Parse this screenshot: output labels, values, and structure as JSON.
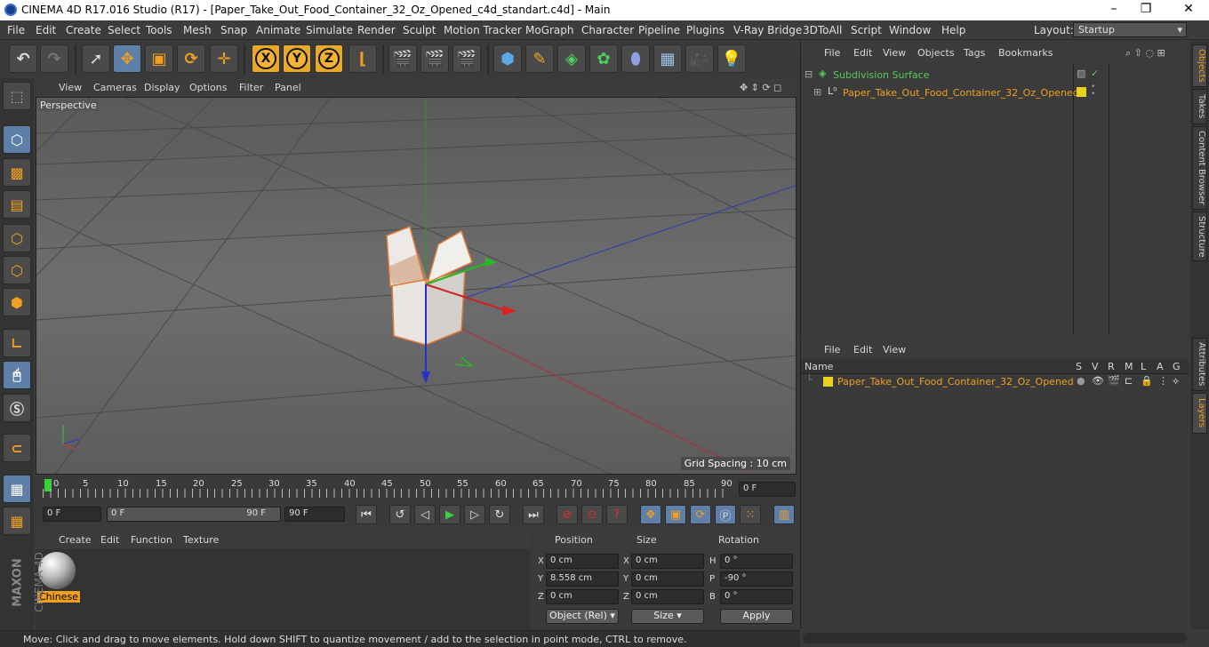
{
  "window": {
    "title": "CINEMA 4D R17.016 Studio (R17) - [Paper_Take_Out_Food_Container_32_Oz_Opened_c4d_standart.c4d] - Main",
    "layout_label": "Layout:",
    "layout_value": "Startup"
  },
  "menubar": [
    "File",
    "Edit",
    "Create",
    "Select",
    "Tools",
    "Mesh",
    "Snap",
    "Animate",
    "Simulate",
    "Render",
    "Sculpt",
    "Motion Tracker",
    "MoGraph",
    "Character",
    "Pipeline",
    "Plugins",
    "V-Ray Bridge",
    "3DToAll",
    "Script",
    "Window",
    "Help"
  ],
  "toolbar": {
    "x_label": "X",
    "y_label": "Y",
    "z_label": "Z"
  },
  "viewport": {
    "menu": [
      "View",
      "Cameras",
      "Display",
      "Options",
      "Filter",
      "Panel"
    ],
    "label": "Perspective",
    "grid_spacing": "Grid Spacing : 10 cm"
  },
  "timeline": {
    "ticks": [
      "0",
      "5",
      "10",
      "15",
      "20",
      "25",
      "30",
      "35",
      "40",
      "45",
      "50",
      "55",
      "60",
      "65",
      "70",
      "75",
      "80",
      "85",
      "90"
    ],
    "current_frame": "0 F",
    "start_field": "0 F",
    "range_start": "0 F",
    "range_end": "90 F",
    "end_field": "90 F"
  },
  "materials": {
    "menu": [
      "Create",
      "Edit",
      "Function",
      "Texture"
    ],
    "items": [
      {
        "name": "Chinese"
      }
    ]
  },
  "coordinates": {
    "headers": [
      "Position",
      "Size",
      "Rotation"
    ],
    "rows": [
      {
        "axis": "X",
        "pos": "0 cm",
        "size_axis": "X",
        "size": "0 cm",
        "rot_axis": "H",
        "rot": "0 °"
      },
      {
        "axis": "Y",
        "pos": "8.558 cm",
        "size_axis": "Y",
        "size": "0 cm",
        "rot_axis": "P",
        "rot": "-90 °"
      },
      {
        "axis": "Z",
        "pos": "0 cm",
        "size_axis": "Z",
        "size": "0 cm",
        "rot_axis": "B",
        "rot": "0 °"
      }
    ],
    "mode": "Object (Rel)",
    "size_mode": "Size",
    "apply": "Apply"
  },
  "status": "Move: Click and drag to move elements. Hold down SHIFT to quantize movement / add to the selection in point mode, CTRL to remove.",
  "objects_panel": {
    "menu": [
      "File",
      "Edit",
      "View",
      "Objects",
      "Tags",
      "Bookmarks"
    ],
    "items": [
      {
        "name": "Subdivision Surface"
      },
      {
        "name": "Paper_Take_Out_Food_Container_32_Oz_Opened"
      }
    ]
  },
  "layers_panel": {
    "menu": [
      "File",
      "Edit",
      "View"
    ],
    "columns": [
      "Name",
      "S",
      "V",
      "R",
      "M",
      "L",
      "A",
      "G"
    ],
    "items": [
      {
        "name": "Paper_Take_Out_Food_Container_32_Oz_Opened"
      }
    ]
  },
  "side_tabs": [
    "Objects",
    "Takes",
    "Content Browser",
    "Structure",
    "Attributes",
    "Layers"
  ],
  "brand": {
    "line1": "MAXON",
    "line2": "CINEMA 4D"
  },
  "colors": {
    "accent": "#f0a020",
    "layer_swatch": "#e8d21e",
    "selected": "#5d7fa8"
  }
}
